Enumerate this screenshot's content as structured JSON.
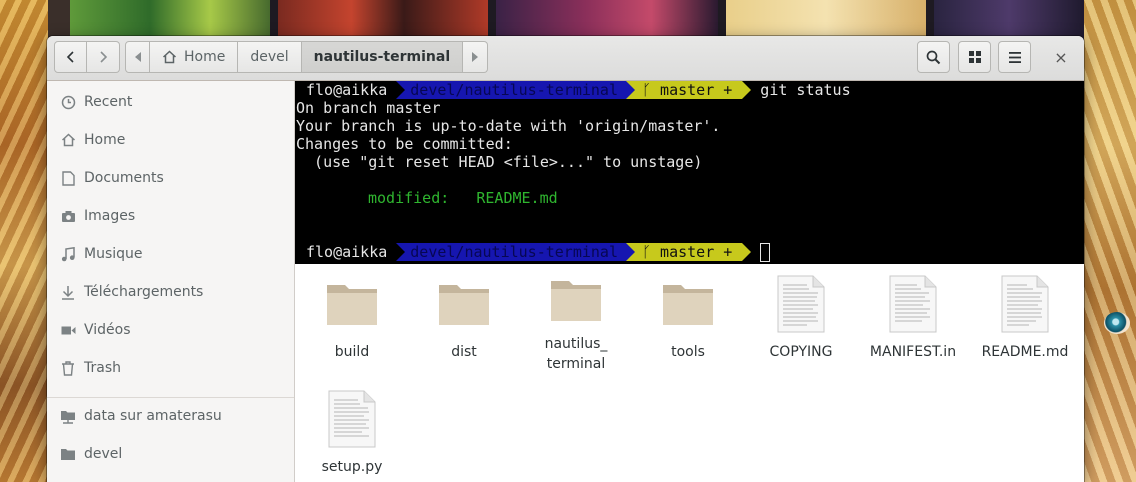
{
  "headerbar": {
    "back_icon": "chevron-left-icon",
    "forward_icon": "chevron-right-icon",
    "path": {
      "crumbs": [
        {
          "label": "Home",
          "icon": "home-icon"
        },
        {
          "label": "devel"
        },
        {
          "label": "nautilus-terminal"
        }
      ]
    },
    "search_icon": "search-icon",
    "view_icon": "grid-view-icon",
    "menu_icon": "hamburger-menu-icon",
    "close_label": "×"
  },
  "sidebar": {
    "items": [
      {
        "label": "Recent",
        "icon": "clock-icon"
      },
      {
        "label": "Home",
        "icon": "home-icon"
      },
      {
        "label": "Documents",
        "icon": "document-icon"
      },
      {
        "label": "Images",
        "icon": "camera-icon"
      },
      {
        "label": "Musique",
        "icon": "music-icon"
      },
      {
        "label": "Téléchargements",
        "icon": "download-icon"
      },
      {
        "label": "Vidéos",
        "icon": "video-icon"
      },
      {
        "label": "Trash",
        "icon": "trash-icon"
      }
    ],
    "bookmarks": [
      {
        "label": "data sur amaterasu",
        "icon": "network-folder-icon"
      },
      {
        "label": "devel",
        "icon": "folder-icon"
      }
    ]
  },
  "terminal": {
    "prompt": {
      "user": "flo@aikka",
      "dir": "devel/nautilus-terminal",
      "branch_glyph": "ᚴ",
      "branch": "master",
      "dirty": "+"
    },
    "command": "git status",
    "output": [
      "On branch master",
      "Your branch is up-to-date with 'origin/master'.",
      "Changes to be committed:",
      "  (use \"git reset HEAD <file>...\" to unstage)"
    ],
    "modified_label": "modified:",
    "modified_file": "README.md"
  },
  "files": [
    {
      "name": "build",
      "type": "folder"
    },
    {
      "name": "dist",
      "type": "folder"
    },
    {
      "name": "nautilus_\nterminal",
      "type": "folder"
    },
    {
      "name": "tools",
      "type": "folder"
    },
    {
      "name": "COPYING",
      "type": "text"
    },
    {
      "name": "MANIFEST.in",
      "type": "text"
    },
    {
      "name": "README.md",
      "type": "text"
    },
    {
      "name": "setup.py",
      "type": "text"
    }
  ],
  "colors": {
    "accent_dir": "#1616b0",
    "accent_git": "#c7c91c",
    "terminal_bg": "#000000",
    "git_modified": "#2fb52f",
    "folder": "#d9cdb8"
  }
}
